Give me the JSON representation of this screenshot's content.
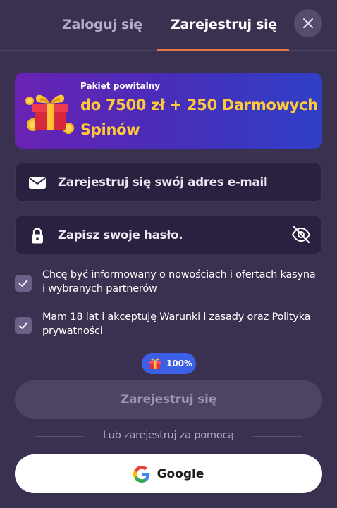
{
  "tabs": {
    "login_label": "Zaloguj się",
    "register_label": "Zarejestruj się",
    "active": "register"
  },
  "icons": {
    "close": "close-icon",
    "gift": "gift-icon",
    "email": "envelope-icon",
    "password": "lock-icon",
    "visibility": "eye-off-icon",
    "check": "checkmark-icon",
    "google": "google-logo-icon"
  },
  "promo": {
    "subtitle": "Pakiet powitalny",
    "title": "do 7500 zł + 250 Darmowych Spinów"
  },
  "form": {
    "email_placeholder": "Zarejestruj się swój adres e-mail",
    "password_placeholder": "Zapisz swoje hasło.",
    "newsletter": {
      "checked": true,
      "text": "Chcę być informowany o nowościach i ofertach kasyna i wybranych partnerów"
    },
    "terms": {
      "checked": true,
      "text_before": "Mam 18 lat i akceptuję ",
      "terms_link": "Warunki i zasady",
      "text_middle": " oraz ",
      "privacy_link": "Polityka prywatności"
    }
  },
  "bonus_badge": {
    "percent": "100%"
  },
  "submit_label": "Zarejestruj się",
  "divider_text": "Lub zarejestruj za pomocą",
  "google_label": "Google",
  "colors": {
    "background": "#3a304f",
    "accent_underline": "#e8744a",
    "promo_gold": "#ffc93a",
    "badge_blue": "#3b5fe6"
  }
}
